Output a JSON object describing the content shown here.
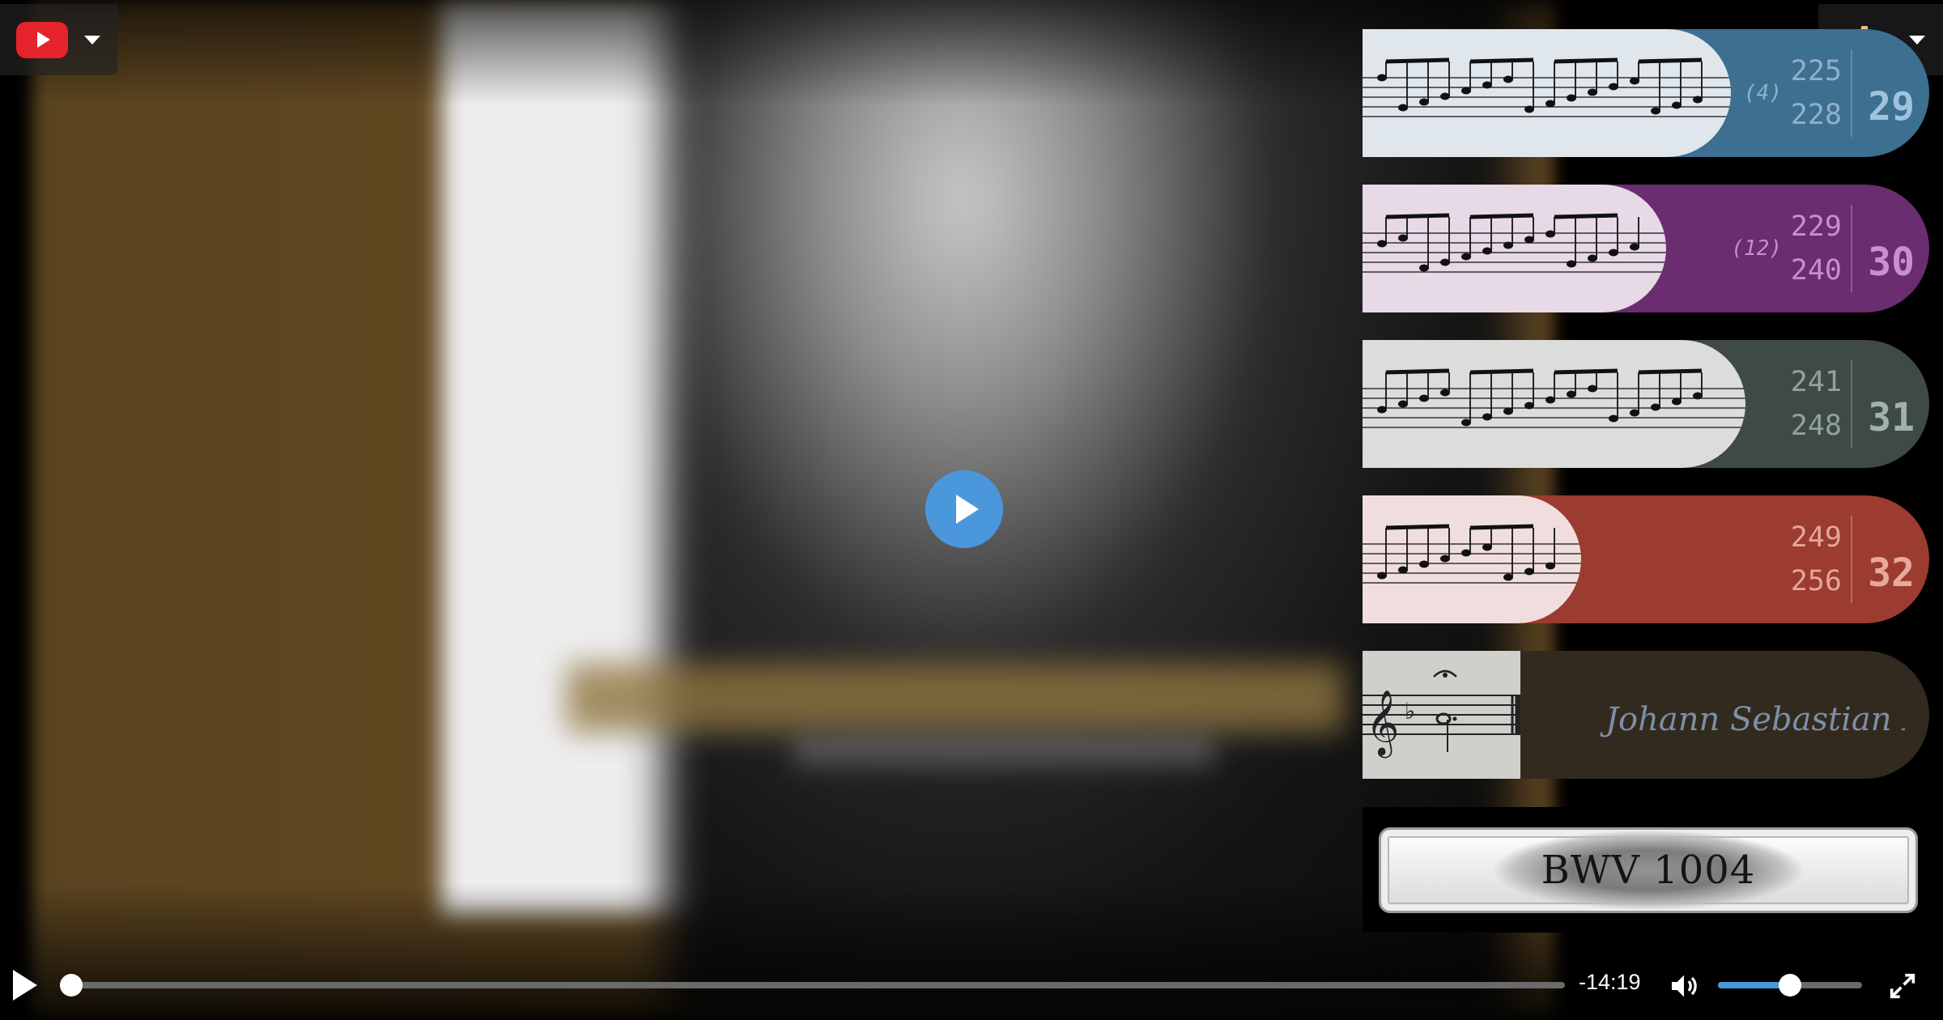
{
  "player": {
    "remaining_time": "-14:19",
    "progress_fraction": 0.0,
    "volume_fraction": 0.5,
    "colors": {
      "accent": "#4a97dc",
      "youtube_red": "#e4232a"
    }
  },
  "icons": {
    "youtube": "youtube-logo-icon",
    "menu_caret": "chevron-down-icon",
    "settings": "gear-icon",
    "play": "play-icon",
    "volume": "volume-icon",
    "fullscreen": "fullscreen-icon"
  },
  "sections": [
    {
      "count": "(4)",
      "measure_start": "225",
      "measure_end": "228",
      "section_number": "29",
      "color": "#3d6f91",
      "score_bg": "#dfe6ec",
      "num_color": "#8fb1c8",
      "big_color": "#9fc3da"
    },
    {
      "count": "(12)",
      "measure_start": "229",
      "measure_end": "240",
      "section_number": "30",
      "color": "#6a2d6f",
      "score_bg": "#e7d9e6",
      "num_color": "#c58fcc",
      "big_color": "#c98fd0"
    },
    {
      "count": "",
      "measure_start": "241",
      "measure_end": "248",
      "section_number": "31",
      "color": "#3f4a46",
      "score_bg": "#dcdcda",
      "num_color": "#8fa39c",
      "big_color": "#9fb3ab"
    },
    {
      "count": "",
      "measure_start": "249",
      "measure_end": "256",
      "section_number": "32",
      "color": "#9c3b2f",
      "score_bg": "#f0dede",
      "num_color": "#e4a69a",
      "big_color": "#e8a99b"
    }
  ],
  "signature_card": {
    "color": "#332a1f",
    "signature": "Johann Sebastian Bach"
  },
  "catalog": {
    "label": "BWV 1004"
  }
}
